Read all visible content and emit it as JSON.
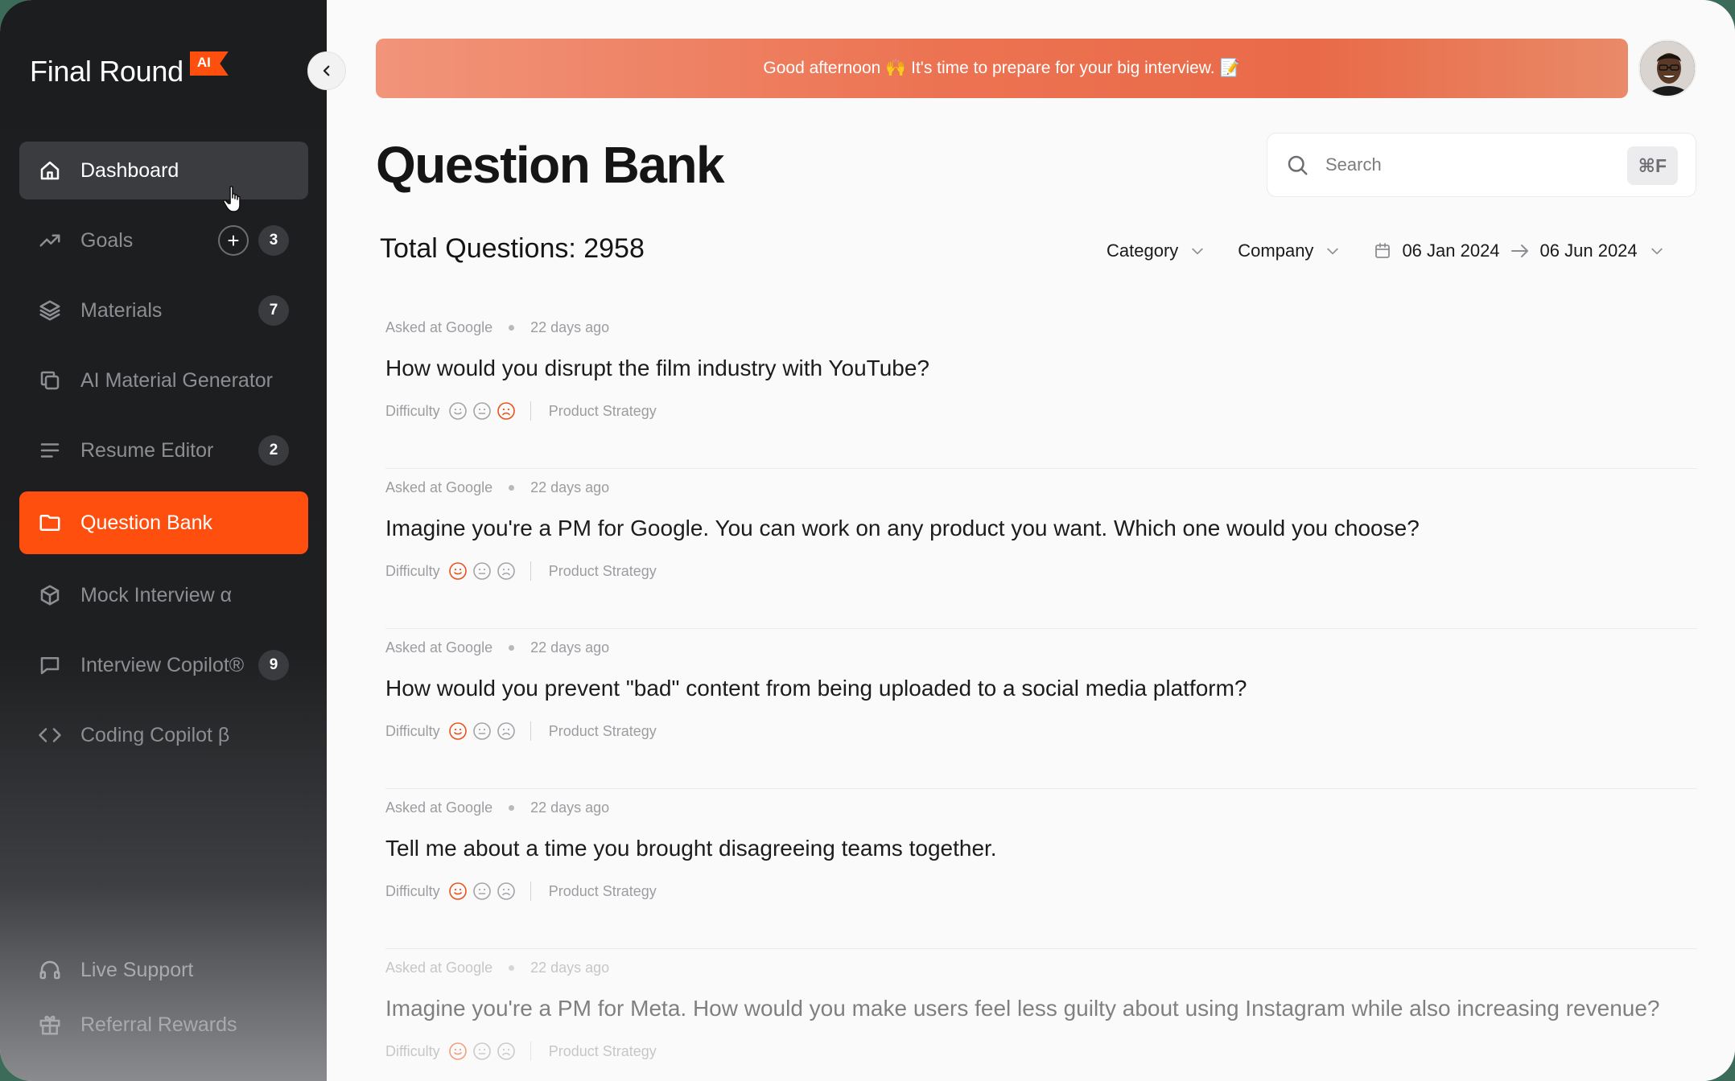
{
  "brand": {
    "name": "Final Round",
    "badge": "AI"
  },
  "sidebar": {
    "items": [
      {
        "label": "Dashboard",
        "icon": "home-icon",
        "state": "hover"
      },
      {
        "label": "Goals",
        "icon": "trend-icon",
        "badge": "3",
        "has_add": true
      },
      {
        "label": "Materials",
        "icon": "layers-icon",
        "badge": "7"
      },
      {
        "label": "AI Material Generator",
        "icon": "copy-icon"
      },
      {
        "label": "Resume Editor",
        "icon": "lines-icon",
        "badge": "2"
      },
      {
        "label": "Question Bank",
        "icon": "folder-icon",
        "state": "active"
      },
      {
        "label": "Mock Interview α",
        "icon": "cube-icon"
      },
      {
        "label": "Interview Copilot®",
        "icon": "chat-icon",
        "badge": "9"
      },
      {
        "label": "Coding Copilot β",
        "icon": "code-icon"
      }
    ],
    "bottom": [
      {
        "label": "Live Support",
        "icon": "headphones-icon"
      },
      {
        "label": "Referral Rewards",
        "icon": "gift-icon"
      }
    ],
    "add_symbol": "+"
  },
  "banner": {
    "text": "Good afternoon 🙌 It's time to prepare for your big interview. 📝"
  },
  "page": {
    "title": "Question Bank"
  },
  "search": {
    "placeholder": "Search",
    "shortcut": "⌘F"
  },
  "summary": {
    "total_label": "Total Questions: 2958"
  },
  "filters": {
    "category": "Category",
    "company": "Company",
    "date_from": "06 Jan 2024",
    "date_to": "06 Jun 2024"
  },
  "questions": [
    {
      "asked_at": "Asked at Google",
      "time": "22 days ago",
      "text": "How would you disrupt the film industry with YouTube?",
      "difficulty_label": "Difficulty",
      "difficulty_level": 3,
      "tag": "Product Strategy"
    },
    {
      "asked_at": "Asked at Google",
      "time": "22 days ago",
      "text": "Imagine you're a PM for Google. You can work on any product you want. Which one would you choose?",
      "difficulty_label": "Difficulty",
      "difficulty_level": 1,
      "tag": "Product Strategy"
    },
    {
      "asked_at": "Asked at Google",
      "time": "22 days ago",
      "text": "How would you prevent \"bad\" content from being uploaded to a social media platform?",
      "difficulty_label": "Difficulty",
      "difficulty_level": 1,
      "tag": "Product Strategy"
    },
    {
      "asked_at": "Asked at Google",
      "time": "22 days ago",
      "text": "Tell me about a time you brought disagreeing teams together.",
      "difficulty_label": "Difficulty",
      "difficulty_level": 1,
      "tag": "Product Strategy"
    },
    {
      "asked_at": "Asked at Google",
      "time": "22 days ago",
      "text": "Imagine you're a PM for Meta. How would you make users feel less guilty about using Instagram while also increasing revenue?",
      "difficulty_label": "Difficulty",
      "difficulty_level": 1,
      "tag": "Product Strategy"
    }
  ],
  "colors": {
    "accent": "#ff4f0f",
    "sidebar_bg": "#1c1d1f",
    "active_face": "#e8531c",
    "inactive_face": "#a3a4a8"
  }
}
